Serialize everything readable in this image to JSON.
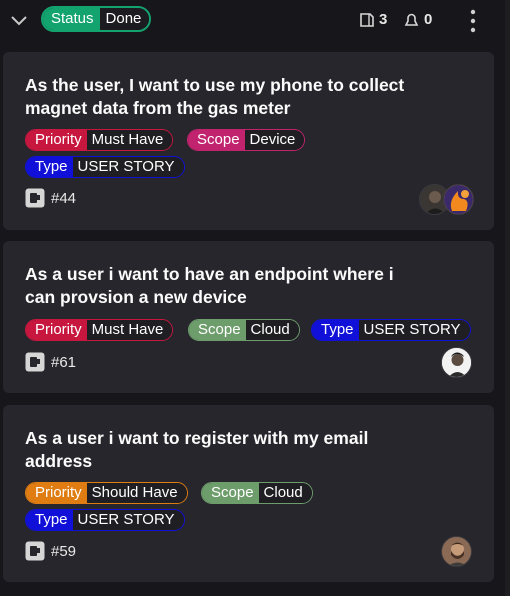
{
  "header": {
    "status_key": "Status",
    "status_value": "Done",
    "status_color": "#13a36f",
    "subissues_count": "3",
    "drafts_count": "0"
  },
  "colors": {
    "priority_must": "#c8173f",
    "priority_should": "#e07d12",
    "scope_device": "#c1236e",
    "scope_cloud": "#6e9d6c",
    "type_story": "#1010d8"
  },
  "cards": [
    {
      "title_line1": "As the user, I want to use my phone to collect",
      "title_line2": "magnet data from the gas meter",
      "priority_key": "Priority",
      "priority_value": "Must Have",
      "scope_key": "Scope",
      "scope_value": "Device",
      "type_key": "Type",
      "type_value": "USER STORY",
      "issue_number": "#44",
      "assignees": [
        "avatar-dark-person",
        "avatar-orange-flame"
      ]
    },
    {
      "title_line1": "As a user i want to have an endpoint where i",
      "title_line2": "can provsion a new device",
      "priority_key": "Priority",
      "priority_value": "Must Have",
      "scope_key": "Scope",
      "scope_value": "Cloud",
      "type_key": "Type",
      "type_value": "USER STORY",
      "issue_number": "#61",
      "assignees": [
        "avatar-person-white-bg"
      ]
    },
    {
      "title_line1": "As a user i want to register with my email",
      "title_line2": "address",
      "priority_key": "Priority",
      "priority_value": "Should Have",
      "scope_key": "Scope",
      "scope_value": "Cloud",
      "type_key": "Type",
      "type_value": "USER STORY",
      "issue_number": "#59",
      "assignees": [
        "avatar-bearded-person"
      ]
    }
  ]
}
